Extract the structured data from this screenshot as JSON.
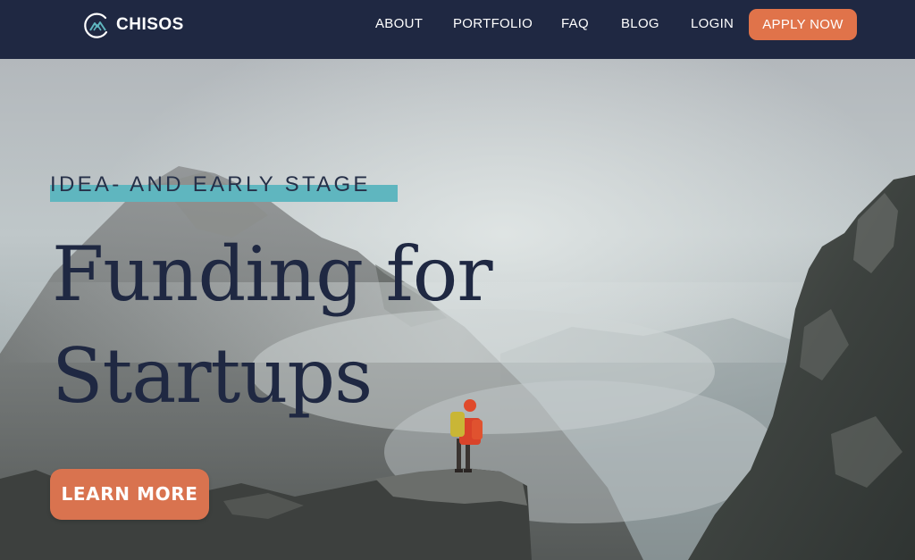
{
  "brand": {
    "name": "CHISOS",
    "icon": "mountain-circle-logo-icon"
  },
  "nav": {
    "items": [
      {
        "label": "ABOUT"
      },
      {
        "label": "PORTFOLIO"
      },
      {
        "label": "FAQ"
      },
      {
        "label": "BLOG"
      },
      {
        "label": "LOGIN"
      }
    ],
    "cta_label": "APPLY NOW"
  },
  "hero": {
    "eyebrow": "IDEA- AND EARLY STAGE",
    "headline_line1": "Funding for",
    "headline_line2": "Startups",
    "cta_label": "LEARN MORE",
    "image": "misty-mountains-hiker-photo"
  },
  "colors": {
    "navy": "#1f2842",
    "accent_orange": "#e0734a",
    "teal_highlight": "#5fb6bf",
    "white": "#ffffff"
  }
}
